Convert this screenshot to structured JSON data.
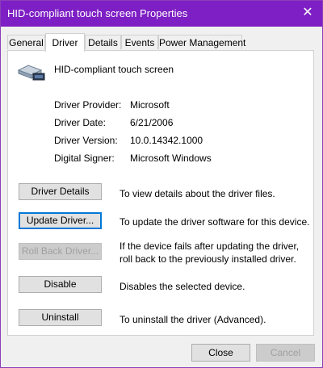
{
  "window": {
    "title": "HID-compliant touch screen Properties",
    "close_glyph": "✕",
    "accent_color": "#7d1fc4"
  },
  "tabs": [
    {
      "label": "General",
      "active": false
    },
    {
      "label": "Driver",
      "active": true
    },
    {
      "label": "Details",
      "active": false
    },
    {
      "label": "Events",
      "active": false
    },
    {
      "label": "Power Management",
      "active": false
    }
  ],
  "device": {
    "icon": "touch-screen-device-icon",
    "name": "HID-compliant touch screen"
  },
  "driver_info": [
    {
      "label": "Driver Provider:",
      "value": "Microsoft"
    },
    {
      "label": "Driver Date:",
      "value": "6/21/2006"
    },
    {
      "label": "Driver Version:",
      "value": "10.0.14342.1000"
    },
    {
      "label": "Digital Signer:",
      "value": "Microsoft Windows"
    }
  ],
  "actions": [
    {
      "button": "Driver Details",
      "description": "To view details about the driver files.",
      "enabled": true
    },
    {
      "button": "Update Driver...",
      "description": "To update the driver software for this device.",
      "enabled": true
    },
    {
      "button": "Roll Back Driver...",
      "description": "If the device fails after updating the driver, roll back to the previously installed driver.",
      "enabled": false
    },
    {
      "button": "Disable",
      "description": "Disables the selected device.",
      "enabled": true
    },
    {
      "button": "Uninstall",
      "description": "To uninstall the driver (Advanced).",
      "enabled": true
    }
  ],
  "footer": {
    "close_label": "Close",
    "cancel_label": "Cancel",
    "cancel_enabled": false
  }
}
